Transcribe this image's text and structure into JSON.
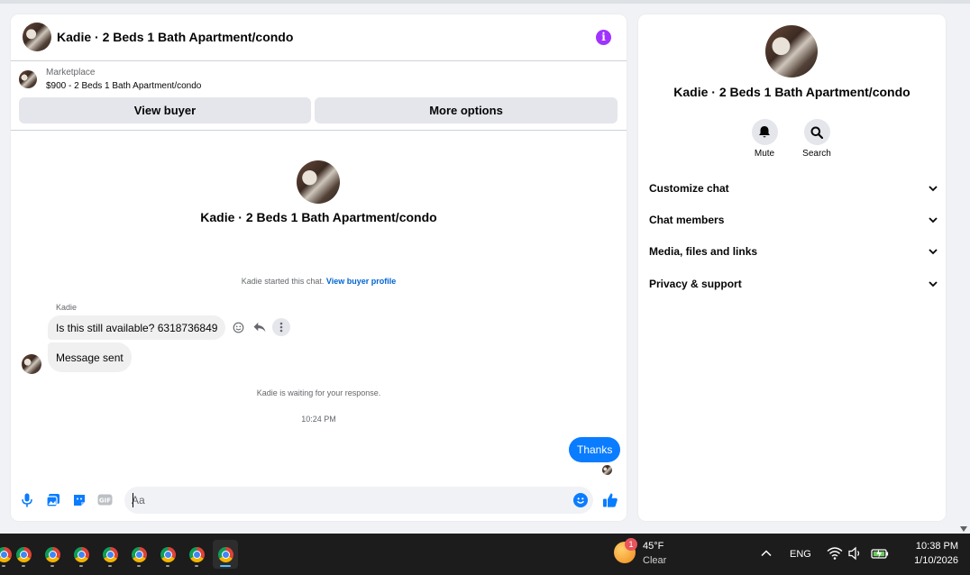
{
  "chat": {
    "title": "Kadie · 2 Beds 1 Bath Apartment/condo",
    "marketplace_label": "Marketplace",
    "marketplace_item": "$900 - 2 Beds 1 Bath Apartment/condo",
    "view_buyer_label": "View buyer",
    "more_options_label": "More options",
    "started_text": "Kadie started this chat.",
    "view_buyer_profile_link": "View buyer profile",
    "sender_name": "Kadie",
    "messages": [
      {
        "text": "Is this still available? 6318736849",
        "direction": "incoming"
      },
      {
        "text": "Message sent",
        "direction": "incoming"
      },
      {
        "text": "Thanks",
        "direction": "outgoing"
      }
    ],
    "waiting_text": "Kadie is waiting for your response.",
    "timestamp": "10:24 PM",
    "composer_placeholder": "Aa",
    "composer_icons": [
      "microphone-icon",
      "image-icon",
      "sticker-icon",
      "gif-icon",
      "emoji-icon",
      "like-icon"
    ],
    "accent_color": "#0a7cff"
  },
  "info_panel": {
    "title": "Kadie · 2 Beds 1 Bath Apartment/condo",
    "actions": [
      {
        "label": "Mute",
        "icon": "bell-icon"
      },
      {
        "label": "Search",
        "icon": "search-icon"
      }
    ],
    "sections": [
      {
        "label": "Customize chat"
      },
      {
        "label": "Chat members"
      },
      {
        "label": "Media, files and links"
      },
      {
        "label": "Privacy & support"
      }
    ]
  },
  "taskbar": {
    "weather_badge": "1",
    "weather_temp": "45°F",
    "weather_condition": "Clear",
    "language": "ENG",
    "time": "10:38 PM",
    "date": "1/10/2026",
    "apps": [
      "chrome",
      "chrome",
      "chrome",
      "chrome",
      "chrome",
      "chrome",
      "chrome",
      "chrome"
    ]
  }
}
